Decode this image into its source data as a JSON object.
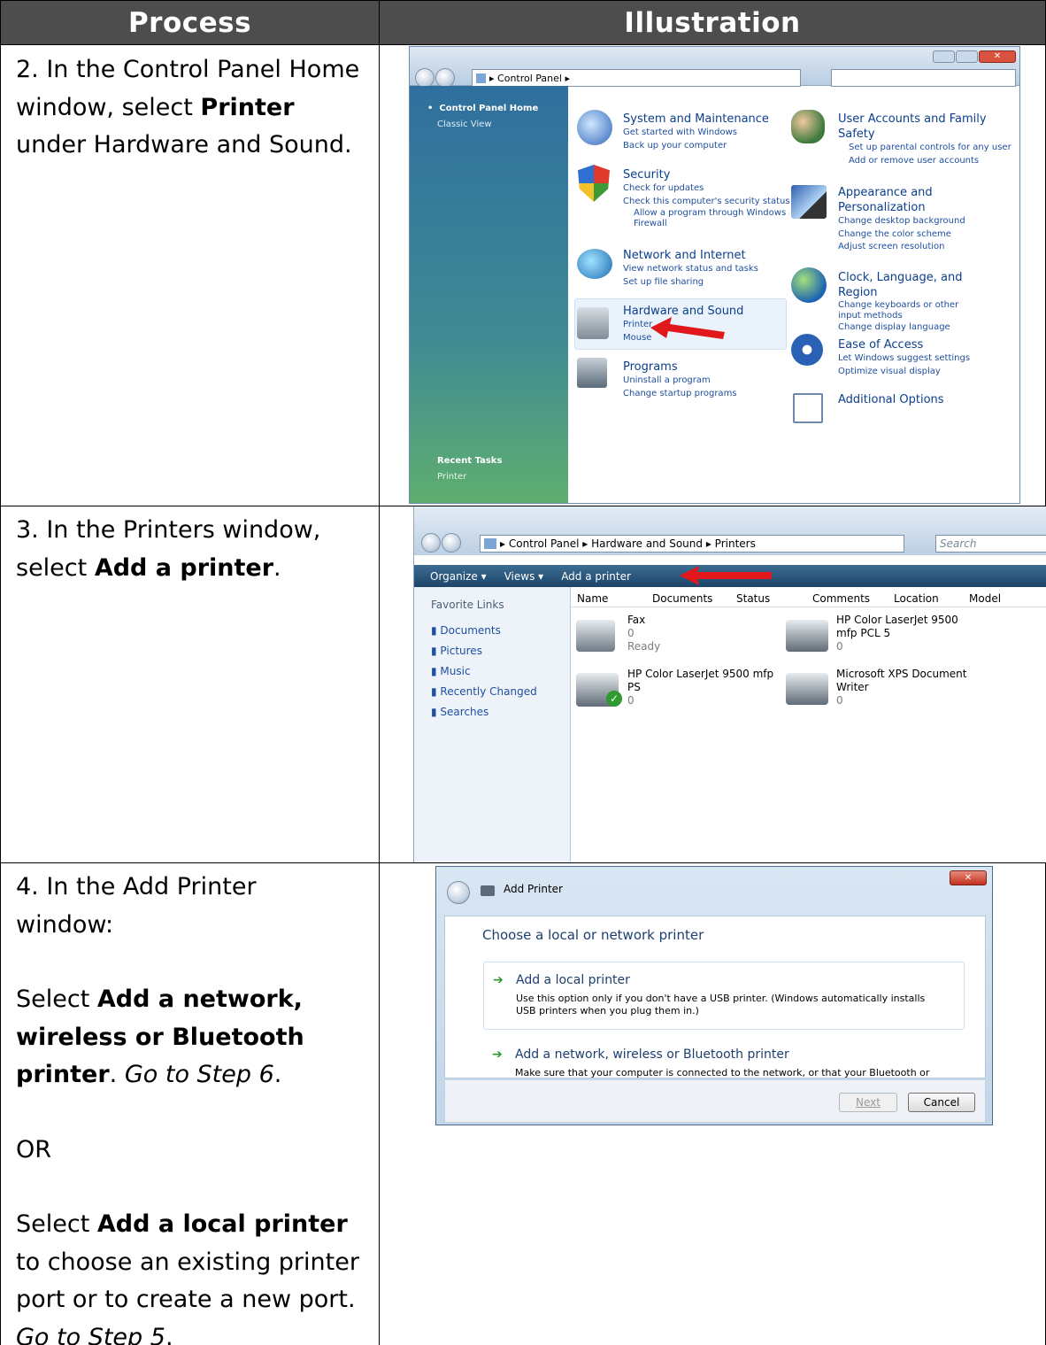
{
  "headers": {
    "process": "Process",
    "illustration": "Illustration"
  },
  "rows": [
    {
      "step_parts": [
        "2. In the Control Panel Home window, select ",
        "Printer",
        " under Hardware and Sound."
      ]
    },
    {
      "step_parts": [
        "3. In the Printers window, select ",
        "Add a printer",
        "."
      ]
    },
    {
      "step_parts": [
        "4. In the Add Printer window:",
        "Select ",
        "Add a network, wireless or Bluetooth printer",
        ". ",
        "Go to Step 6",
        ".",
        "OR",
        "Select ",
        "Add a local printer",
        " to choose an existing printer port or to create a new port. ",
        "Go to Step 5",
        "."
      ]
    }
  ],
  "cp": {
    "address": "Control Panel",
    "sidebar_home": "Control Panel Home",
    "sidebar_classic": "Classic View",
    "recent_title": "Recent Tasks",
    "recent_item": "Printer",
    "left": [
      {
        "title": "System and Maintenance",
        "links": [
          "Get started with Windows",
          "Back up your computer"
        ]
      },
      {
        "title": "Security",
        "links": [
          "Check for updates",
          "Check this computer's security status",
          "Allow a program through Windows Firewall"
        ]
      },
      {
        "title": "Network and Internet",
        "links": [
          "View network status and tasks",
          "Set up file sharing"
        ]
      },
      {
        "title": "Hardware and Sound",
        "links": [
          "Printer",
          "Mouse"
        ]
      },
      {
        "title": "Programs",
        "links": [
          "Uninstall a program",
          "Change startup programs"
        ]
      }
    ],
    "right": [
      {
        "title": "User Accounts and Family Safety",
        "links": [
          "Set up parental controls for any user",
          "Add or remove user accounts"
        ]
      },
      {
        "title": "Appearance and Personalization",
        "links": [
          "Change desktop background",
          "Change the color scheme",
          "Adjust screen resolution"
        ]
      },
      {
        "title": "Clock, Language, and Region",
        "links": [
          "Change keyboards or other input methods",
          "Change display language"
        ]
      },
      {
        "title": "Ease of Access",
        "links": [
          "Let Windows suggest settings",
          "Optimize visual display"
        ]
      },
      {
        "title": "Additional Options",
        "links": []
      }
    ]
  },
  "printers": {
    "breadcrumb": [
      "Control Panel",
      "Hardware and Sound",
      "Printers"
    ],
    "search_placeholder": "Search",
    "toolbar": [
      "Organize",
      "Views",
      "Add a printer"
    ],
    "favorite_title": "Favorite Links",
    "favorites": [
      "Documents",
      "Pictures",
      "Music",
      "Recently Changed",
      "Searches"
    ],
    "columns": [
      "Name",
      "Documents",
      "Status",
      "Comments",
      "Location",
      "Model"
    ],
    "items": [
      {
        "name": "Fax",
        "docs": "0",
        "status": "Ready"
      },
      {
        "name": "HP Color LaserJet 9500 mfp PCL 5",
        "docs": "0",
        "status": ""
      },
      {
        "name": "HP Color LaserJet 9500 mfp PS",
        "docs": "0",
        "status": ""
      },
      {
        "name": "Microsoft XPS Document Writer",
        "docs": "0",
        "status": ""
      }
    ]
  },
  "addprinter": {
    "title": "Add Printer",
    "heading": "Choose a local or network printer",
    "opt1_title": "Add a local printer",
    "opt1_desc": "Use this option only if you don't have a USB printer. (Windows automatically installs USB printers when you plug them in.)",
    "opt2_title": "Add a network, wireless or Bluetooth printer",
    "opt2_desc": "Make sure that your computer is connected to the network, or that your Bluetooth or wireless printer is turned on.",
    "next": "Next",
    "cancel": "Cancel",
    "close": "✕"
  }
}
